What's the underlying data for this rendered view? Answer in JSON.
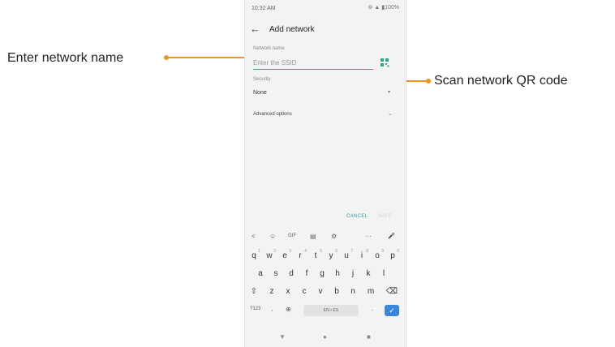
{
  "callouts": {
    "left_label": "Enter network name",
    "right_label": "Scan network QR code"
  },
  "status_bar": {
    "time": "10:32 AM",
    "icons": "⊚ ▲ ▮100%"
  },
  "app_bar": {
    "title": "Add network"
  },
  "network_name": {
    "label": "Network name",
    "placeholder": "Enter the SSID",
    "value": ""
  },
  "security": {
    "label": "Security",
    "value": "None"
  },
  "advanced": {
    "label": "Advanced options"
  },
  "actions": {
    "cancel": "CANCEL",
    "save": "SAVE"
  },
  "keyboard": {
    "toolbar": [
      "<",
      "☺",
      "GIF",
      "▤",
      "⚙",
      "···",
      "🎤"
    ],
    "row1": [
      {
        "k": "q",
        "s": "1"
      },
      {
        "k": "w",
        "s": "2"
      },
      {
        "k": "e",
        "s": "3"
      },
      {
        "k": "r",
        "s": "4"
      },
      {
        "k": "t",
        "s": "5"
      },
      {
        "k": "y",
        "s": "6"
      },
      {
        "k": "u",
        "s": "7"
      },
      {
        "k": "i",
        "s": "8"
      },
      {
        "k": "o",
        "s": "9"
      },
      {
        "k": "p",
        "s": "0"
      }
    ],
    "row2": [
      "a",
      "s",
      "d",
      "f",
      "g",
      "h",
      "j",
      "k",
      "l"
    ],
    "row3": [
      "z",
      "x",
      "c",
      "v",
      "b",
      "n",
      "m"
    ],
    "symbols": "?123",
    "comma": ",",
    "space": "EN • ES",
    "period": "."
  },
  "nav": {
    "back": "▼",
    "home": "●",
    "recents": "■"
  },
  "colors": {
    "accent": "#2fa58f",
    "callout": "#f29222",
    "enter": "#3a86d8"
  }
}
